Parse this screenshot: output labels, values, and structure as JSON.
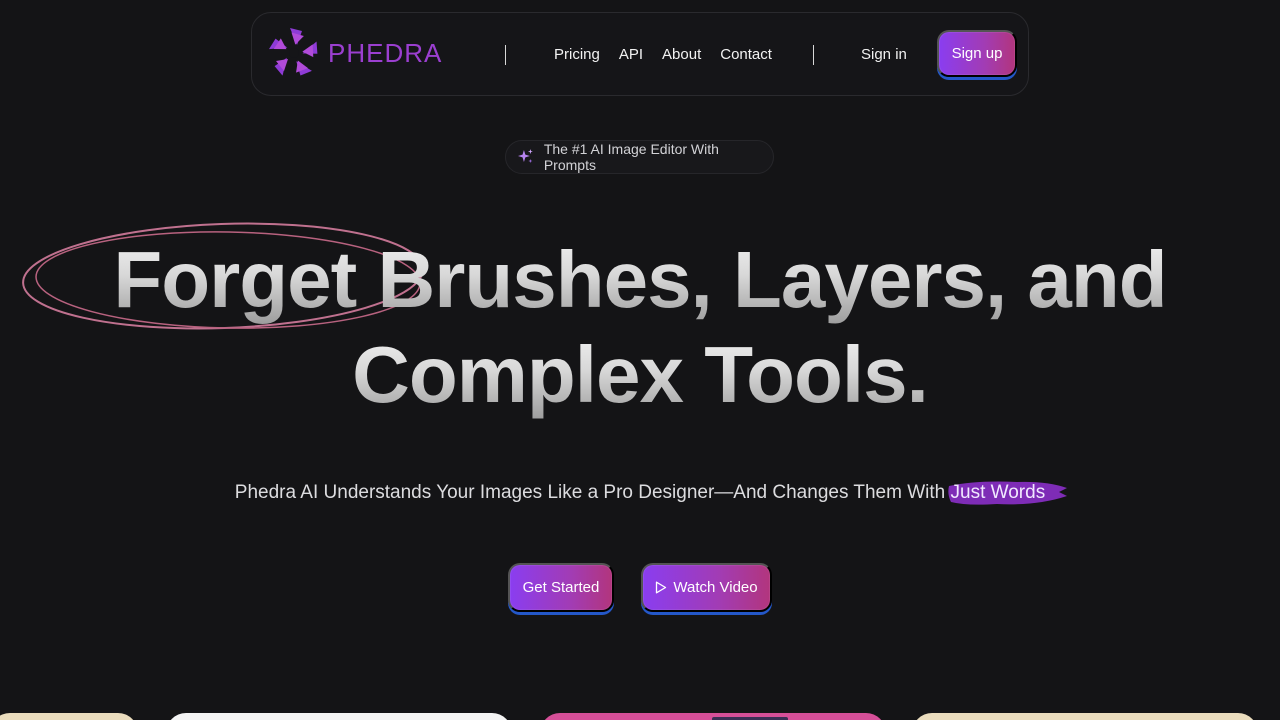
{
  "brand": {
    "name": "PHEDRA",
    "logo_color": "#9b3fd0"
  },
  "nav": {
    "links": [
      "Pricing",
      "API",
      "About",
      "Contact"
    ],
    "signin_label": "Sign in",
    "signup_label": "Sign up"
  },
  "badge": {
    "icon": "sparkles-icon",
    "text": "The #1 AI Image Editor With Prompts"
  },
  "hero": {
    "headline_line1": "Forget Brushes, Layers, and",
    "headline_line2": "Complex Tools.",
    "subtitle_prefix": "Phedra AI Understands Your Images Like a Pro Designer—And Changes Them With",
    "subtitle_highlight": "Just Words"
  },
  "cta": {
    "primary_label": "Get Started",
    "secondary_label": "Watch Video",
    "secondary_icon": "play-icon"
  },
  "colors": {
    "background": "#141416",
    "button_gradient_start": "#8a3df0",
    "button_gradient_end": "#b2357d",
    "button_shadow": "#2458c9",
    "scribble": "#c0718f",
    "highlight_brush": "#8a2fc8"
  }
}
